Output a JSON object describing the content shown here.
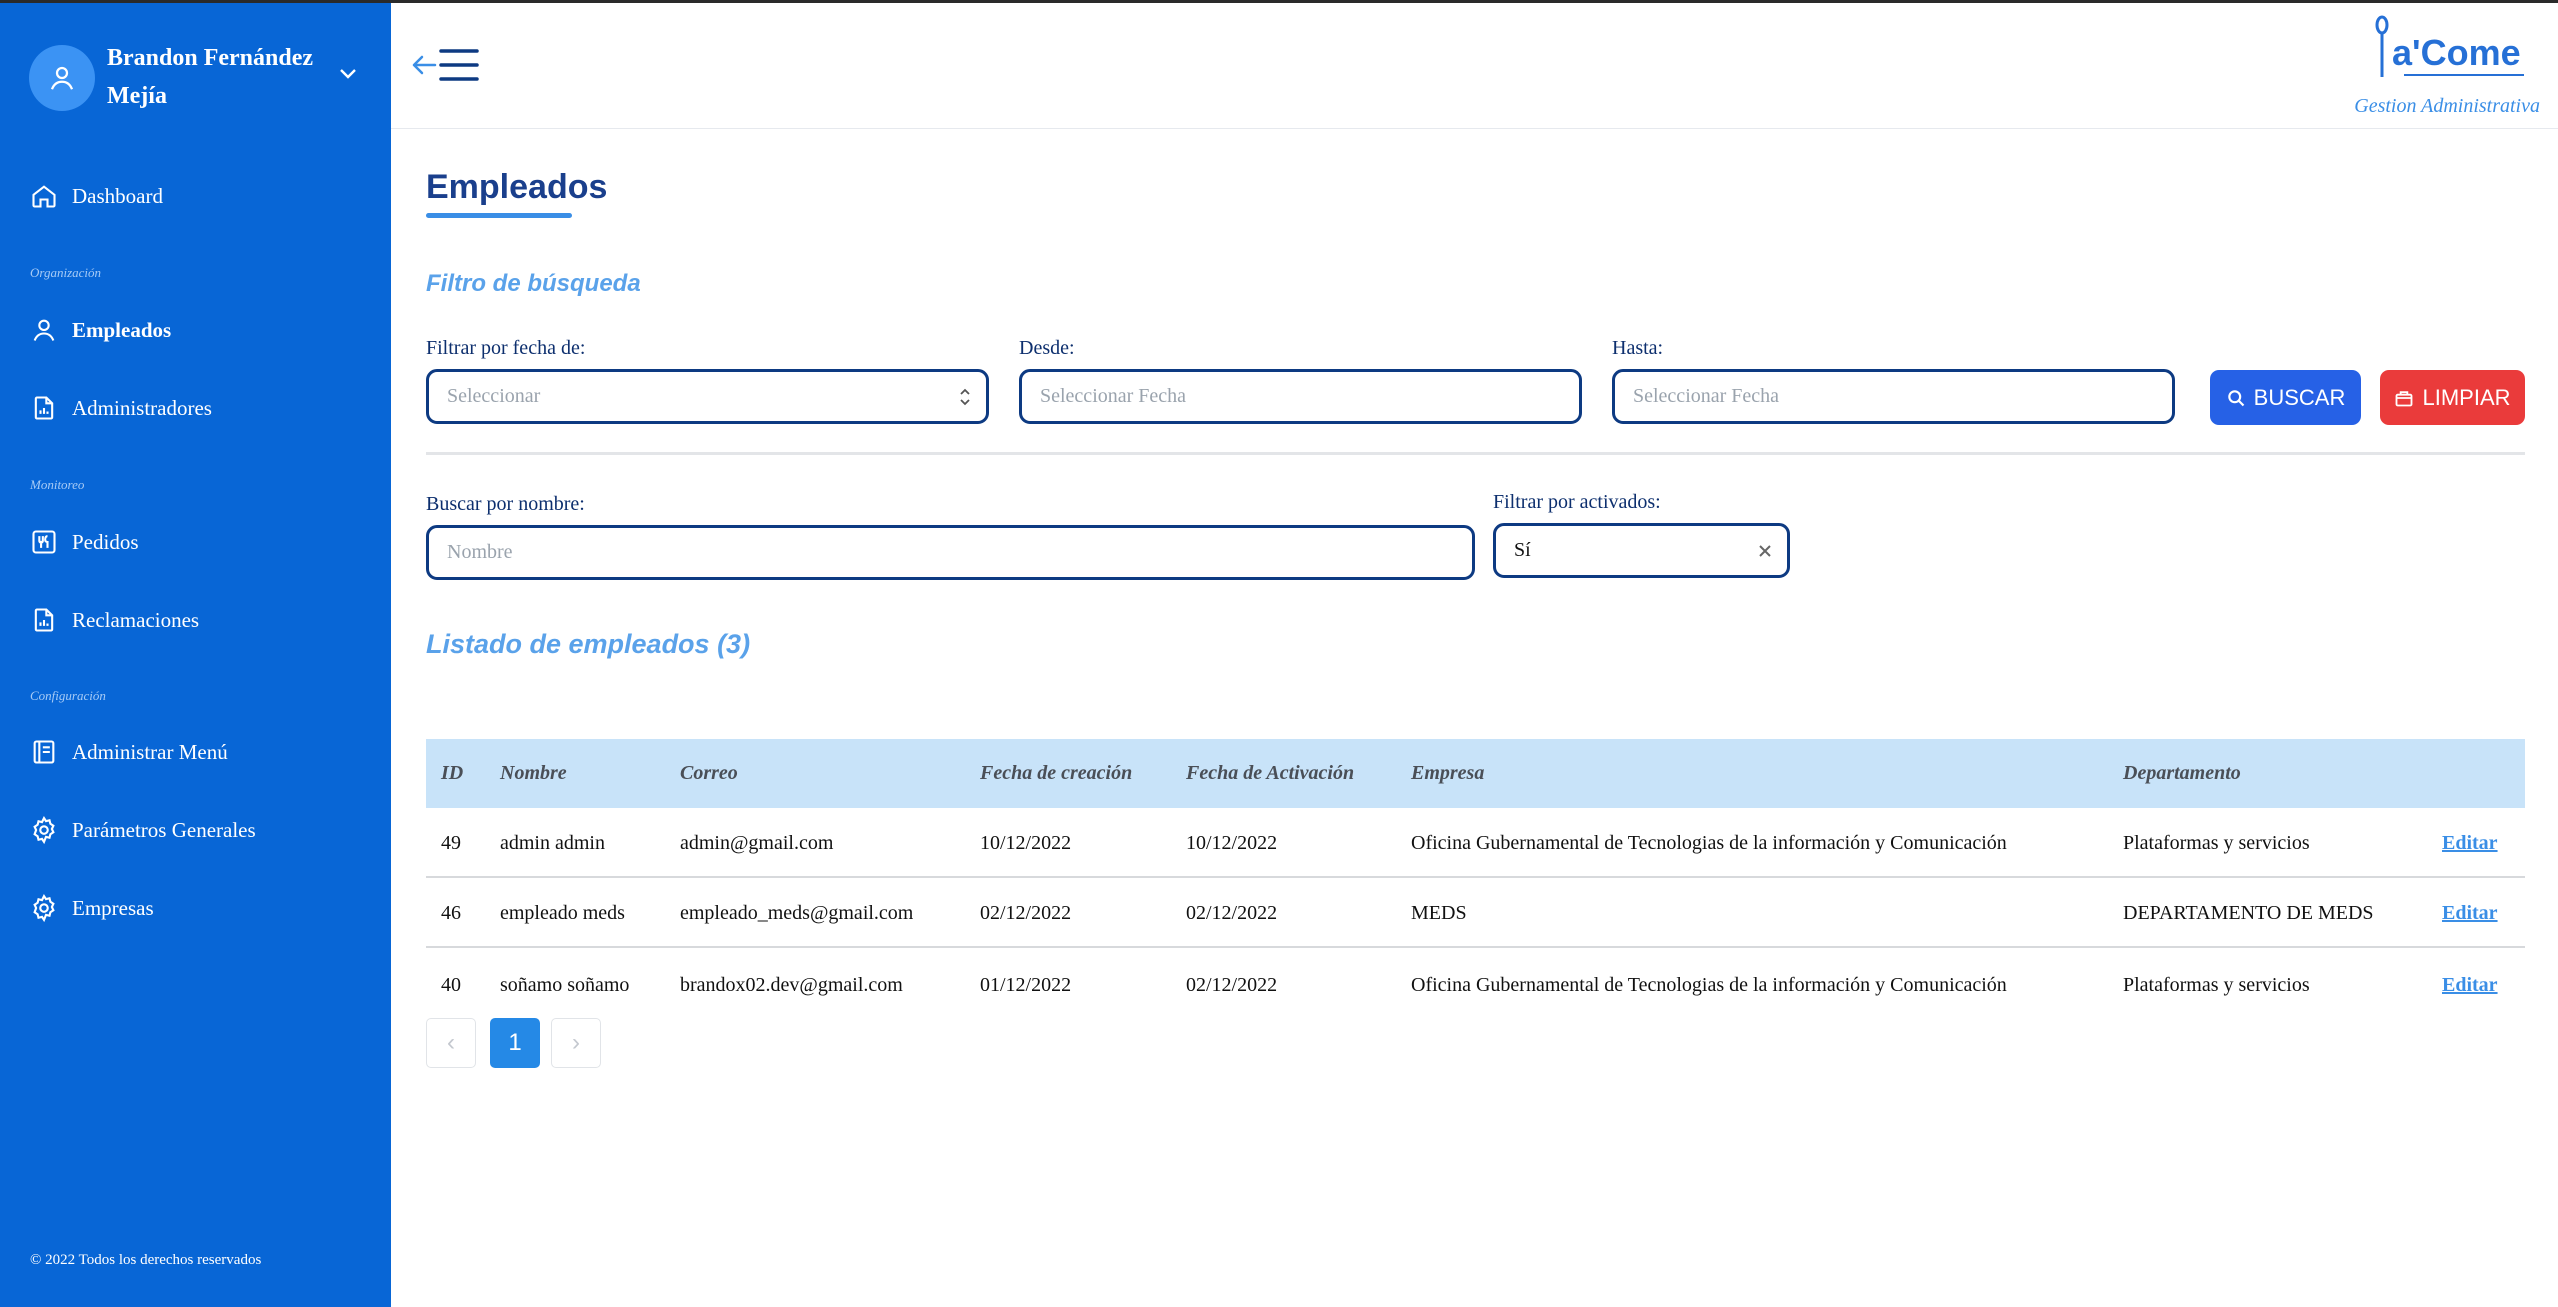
{
  "user": {
    "name": "Brandon Fernández Mejía"
  },
  "sidebar": {
    "items": [
      {
        "label": "Dashboard",
        "icon": "home-icon"
      },
      {
        "label": "Empleados",
        "icon": "user-icon",
        "active": true
      },
      {
        "label": "Administradores",
        "icon": "report-icon"
      },
      {
        "label": "Pedidos",
        "icon": "utensils-icon"
      },
      {
        "label": "Reclamaciones",
        "icon": "report-icon"
      },
      {
        "label": "Administrar Menú",
        "icon": "menu-book-icon"
      },
      {
        "label": "Parámetros Generales",
        "icon": "gear-icon"
      },
      {
        "label": "Empresas",
        "icon": "gear-icon"
      }
    ],
    "sections": [
      "Organización",
      "Monitoreo",
      "Configuración"
    ],
    "footer": "© 2022 Todos los derechos reservados"
  },
  "header": {
    "logo_text": "a'Come",
    "subtitle": "Gestion Administrativa"
  },
  "page": {
    "title": "Empleados",
    "filter_title": "Filtro de búsqueda",
    "list_title": "Listado de empleados (3)"
  },
  "filters": {
    "date_type_label": "Filtrar por fecha de:",
    "date_type_placeholder": "Seleccionar",
    "from_label": "Desde:",
    "from_placeholder": "Seleccionar Fecha",
    "to_label": "Hasta:",
    "to_placeholder": "Seleccionar Fecha",
    "search_button": "BUSCAR",
    "clear_button": "LIMPIAR",
    "name_label": "Buscar por nombre:",
    "name_placeholder": "Nombre",
    "active_label": "Filtrar por activados:",
    "active_value": "Sí"
  },
  "table": {
    "columns": [
      "ID",
      "Nombre",
      "Correo",
      "Fecha de creación",
      "Fecha de Activación",
      "Empresa",
      "Departamento"
    ],
    "edit_label": "Editar",
    "rows": [
      {
        "id": "49",
        "nombre": "admin admin",
        "correo": "admin@gmail.com",
        "creacion": "10/12/2022",
        "activacion": "10/12/2022",
        "empresa": "Oficina Gubernamental de Tecnologias de la información y Comunicación",
        "departamento": "Plataformas y servicios"
      },
      {
        "id": "46",
        "nombre": "empleado meds",
        "correo": "empleado_meds@gmail.com",
        "creacion": "02/12/2022",
        "activacion": "02/12/2022",
        "empresa": "MEDS",
        "departamento": "DEPARTAMENTO DE MEDS"
      },
      {
        "id": "40",
        "nombre": "soñamo soñamo",
        "correo": "brandox02.dev@gmail.com",
        "creacion": "01/12/2022",
        "activacion": "02/12/2022",
        "empresa": "Oficina Gubernamental de Tecnologias de la información y Comunicación",
        "departamento": "Plataformas y servicios"
      }
    ]
  },
  "pagination": {
    "current_page": "1",
    "prev": "‹",
    "next": "›"
  },
  "colors": {
    "sidebar": "#0866d6",
    "accent": "#3a8ee6",
    "title": "#1a3f8c",
    "buscar": "#2661e6",
    "limpiar": "#ea3b3b",
    "table_header": "#c8e3f9"
  }
}
